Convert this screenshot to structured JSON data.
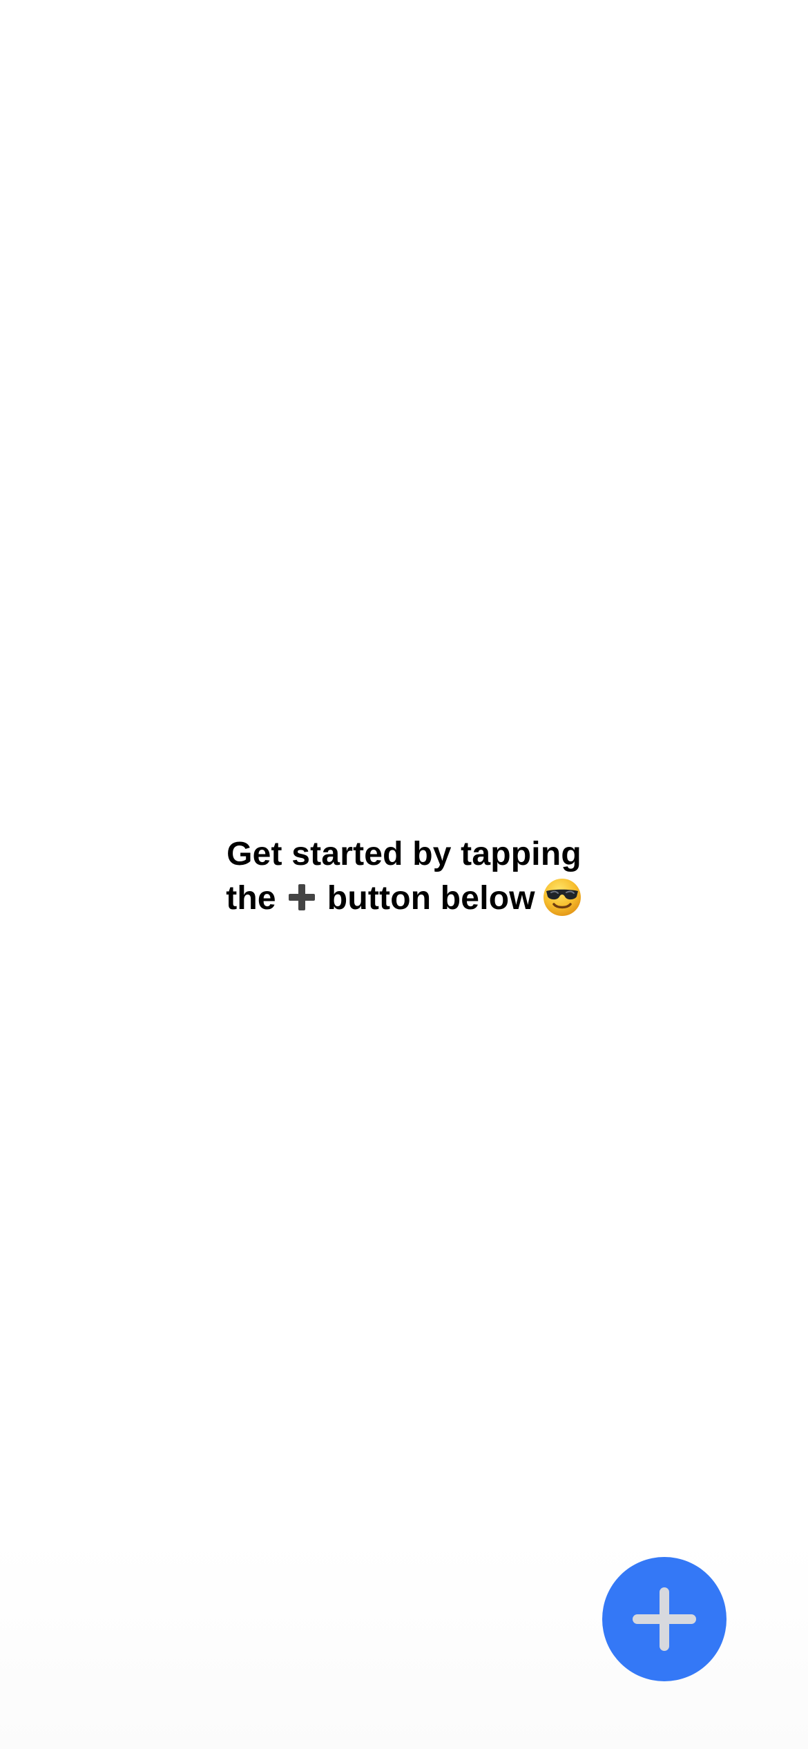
{
  "empty_state": {
    "line1": "Get started by tapping",
    "line2_before": "the",
    "plus_icon": "heavy-plus-icon",
    "line2_after": "button below",
    "emoji_icon": "smiling-face-with-sunglasses-icon"
  },
  "fab": {
    "icon": "plus-icon",
    "background_color": "#3478F6",
    "icon_color": "#D7D9DE"
  },
  "colors": {
    "background": "#FFFFFF",
    "text": "#000000",
    "inline_plus": "#444444"
  }
}
